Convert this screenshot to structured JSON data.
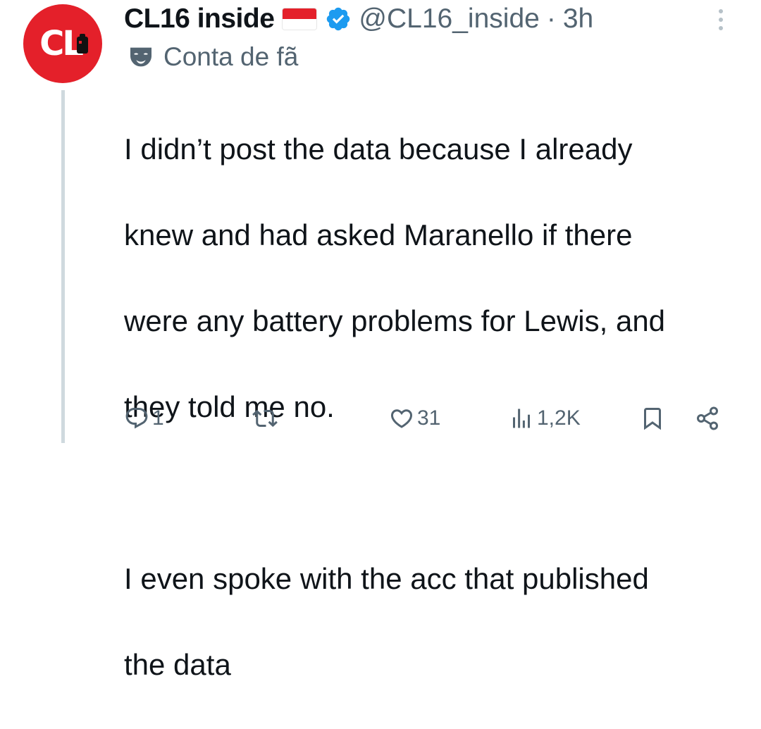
{
  "post": {
    "display_name": "CL16 inside",
    "handle": "@CL16_inside",
    "separator": "·",
    "time": "3h",
    "label": "Conta de fã",
    "avatar_text": "CL",
    "text_lines": [
      "I didn’t post the data because I already",
      "knew and had asked Maranello if there",
      "were any battery problems for Lewis, and",
      "they told me no.",
      "",
      "I even spoke with the acc that published",
      "the data"
    ]
  },
  "actions": {
    "reply_count": "1",
    "repost_count": "",
    "like_count": "31",
    "views_count": "1,2K"
  },
  "icons": {
    "avatar": "cl16-logo",
    "flag": "indonesia-flag",
    "verified": "verified-badge-icon",
    "more": "more-vertical-icon",
    "label": "mask-icon",
    "reply": "reply-icon",
    "repost": "repost-icon",
    "like": "heart-icon",
    "views": "views-icon",
    "bookmark": "bookmark-icon",
    "share": "share-icon"
  },
  "colors": {
    "text": "#0f1419",
    "secondary": "#536471",
    "verified": "#1d9bf0",
    "avatar_bg": "#e4202a",
    "thread_line": "#cfd9de"
  }
}
